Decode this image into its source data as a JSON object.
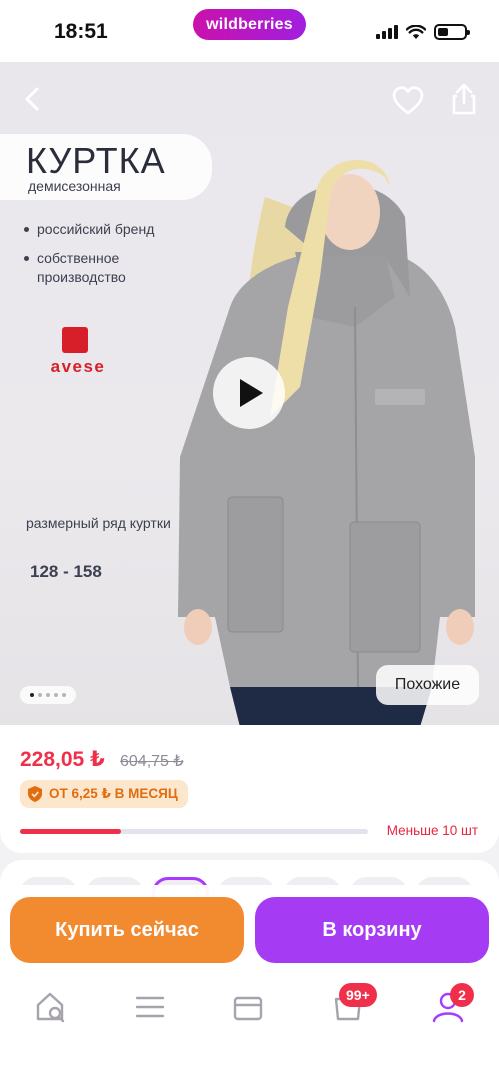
{
  "status_bar": {
    "time": "18:51",
    "brand": "wildberries"
  },
  "gallery": {
    "title": "КУРТКА",
    "subtitle": "демисезонная",
    "bullets": [
      "российский бренд",
      "собственное производство"
    ],
    "brand_name": "avese",
    "size_label": "размерный ряд куртки",
    "size_range": "128 - 158",
    "similar_label": "Похожие",
    "slide_index": 1,
    "slide_count": 5
  },
  "price": {
    "current": "228,05 ₺",
    "old": "604,75 ₺",
    "installment": "ОТ 6,25 ₺ В МЕСЯЦ",
    "stock_text": "Меньше 10 шт",
    "stock_fraction": 0.29
  },
  "actions": {
    "buy_now": "Купить сейчас",
    "add_to_cart": "В корзину"
  },
  "tabbar": {
    "cart_badge": "99+",
    "profile_badge": "2"
  },
  "colors": {
    "price": "#f0304b",
    "buy_button": "#f28a30",
    "cart_button": "#a53bf2",
    "brand_gradient_start": "#cb11ab",
    "brand_gradient_end": "#a11fdf",
    "installment_bg": "#fde7cc",
    "installment_text": "#e06d0f"
  },
  "icons": {
    "back": "chevron-left-icon",
    "favorite": "heart-icon",
    "share": "share-icon",
    "play": "play-icon",
    "home": "home-search-icon",
    "catalog": "menu-icon",
    "cart": "cart-icon",
    "profile": "profile-icon"
  }
}
